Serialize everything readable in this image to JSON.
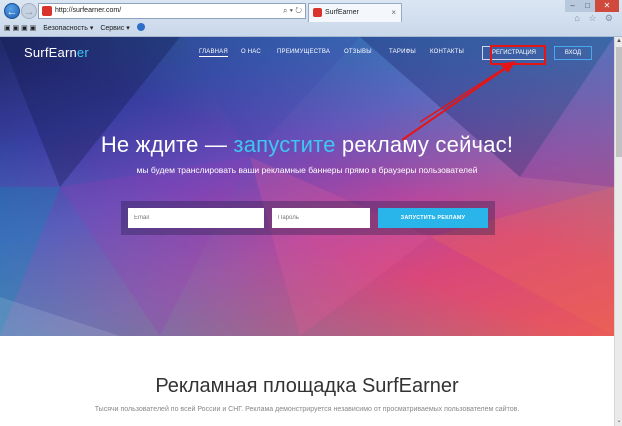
{
  "browser": {
    "url": "http://surfearner.com/",
    "tab_title": "SurfEarner",
    "tab_close": "×",
    "back_glyph": "←",
    "forward_glyph": "→",
    "address_tools": "⌕ ▾ ↻",
    "window_min": "–",
    "window_max": "□",
    "window_close": "✕",
    "chrome_icons": "⌂ ☆ ⚙",
    "command_bar": [
      "Безопасность ▾",
      "Сервис ▾"
    ]
  },
  "nav": {
    "brand_main": "SurfEarn",
    "brand_accent": "er",
    "items": [
      "ГЛАВНАЯ",
      "О НАС",
      "ПРЕИМУЩЕСТВА",
      "ОТЗЫВЫ",
      "ТАРИФЫ",
      "КОНТАКТЫ"
    ],
    "register": "РЕГИСТРАЦИЯ",
    "login": "ВХОД"
  },
  "hero": {
    "headline_part1": "Не ждите — ",
    "headline_accent": "запустите",
    "headline_part2": " рекламу сейчас!",
    "subline": "мы будем транслировать ваши рекламные баннеры прямо в браузеры пользователей"
  },
  "form": {
    "email_placeholder": "Email",
    "password_placeholder": "Пароль",
    "submit": "ЗАПУСТИТЬ РЕКЛАМУ"
  },
  "section": {
    "title": "Рекламная площадка SurfEarner",
    "text": "Тысячи пользователей по всей России и СНГ. Реклама демонстрируется независимо от просматриваемых пользователем сайтов."
  },
  "scrollbar": {
    "up_glyph": "▲",
    "down_glyph": "⌄"
  },
  "colors": {
    "accent": "#3fc7f2",
    "button": "#29b4ea",
    "annotation": "#e61414"
  }
}
